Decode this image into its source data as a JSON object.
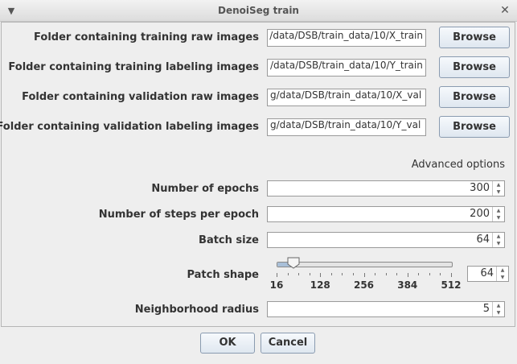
{
  "window": {
    "title": "DenoiSeg train"
  },
  "folders": [
    {
      "label": "Folder containing training raw images",
      "path": "/data/DSB/train_data/10/X_train",
      "button": "Browse"
    },
    {
      "label": "Folder containing training labeling images",
      "path": "/data/DSB/train_data/10/Y_train",
      "button": "Browse"
    },
    {
      "label": "Folder containing validation raw images",
      "path": "g/data/DSB/train_data/10/X_val",
      "button": "Browse"
    },
    {
      "label": "Folder containing validation labeling images",
      "path": "g/data/DSB/train_data/10/Y_val",
      "button": "Browse"
    }
  ],
  "advanced_options_label": "Advanced options",
  "params": {
    "epochs": {
      "label": "Number of epochs",
      "value": "300"
    },
    "steps": {
      "label": "Number of steps per epoch",
      "value": "200"
    },
    "batch": {
      "label": "Batch size",
      "value": "64"
    },
    "neighborhood": {
      "label": "Neighborhood radius",
      "value": "5"
    }
  },
  "patch_shape": {
    "label": "Patch shape",
    "value": "64",
    "slider_value": 64,
    "min": 16,
    "max": 512,
    "tick_labels": [
      "16",
      "128",
      "256",
      "384",
      "512"
    ]
  },
  "footer": {
    "ok": "OK",
    "cancel": "Cancel"
  },
  "icons": {
    "menu": "chevron-down-icon",
    "close": "close-icon"
  },
  "colors": {
    "accent": "#a8bfd8",
    "button_border": "#8a9bb0"
  }
}
